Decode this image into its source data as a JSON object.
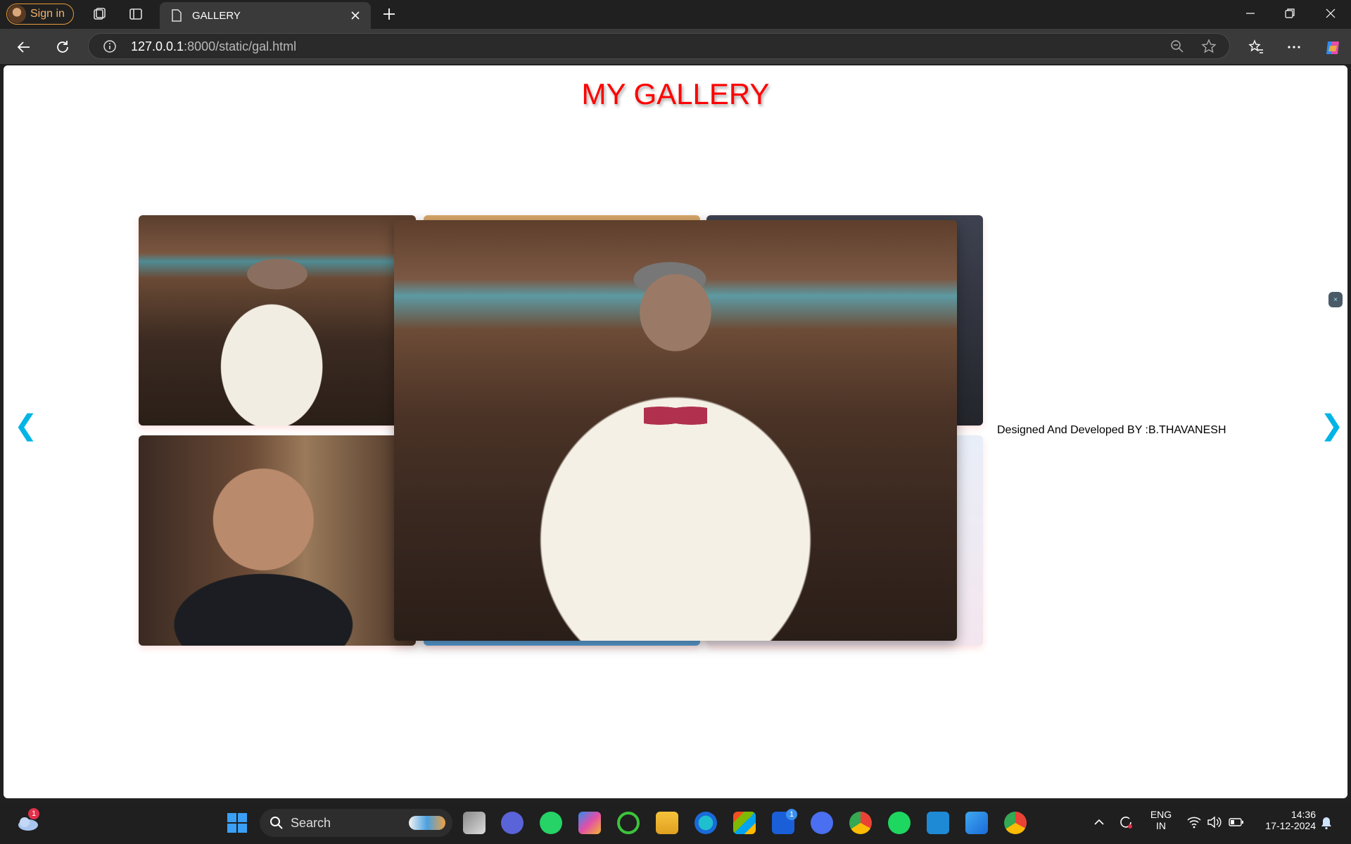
{
  "browser": {
    "signin_label": "Sign in",
    "tab_title": "GALLERY",
    "url_host": "127.0.0.1",
    "url_rest": ":8000/static/gal.html"
  },
  "page": {
    "title": "MY GALLERY",
    "prev_arrow": "❮",
    "next_arrow": "❯",
    "credit": "Designed And Developed BY :B.THAVANESH",
    "close_glyph": "×"
  },
  "taskbar": {
    "search_placeholder": "Search",
    "weather_badge": "1",
    "app_badge": "1",
    "lang_top": "ENG",
    "lang_bottom": "IN",
    "time": "14:36",
    "date": "17-12-2024"
  },
  "colors": {
    "title": "#ff0000",
    "arrow": "#00b4e6",
    "page_bg": "#ffffff",
    "chrome_bg": "#202020"
  }
}
